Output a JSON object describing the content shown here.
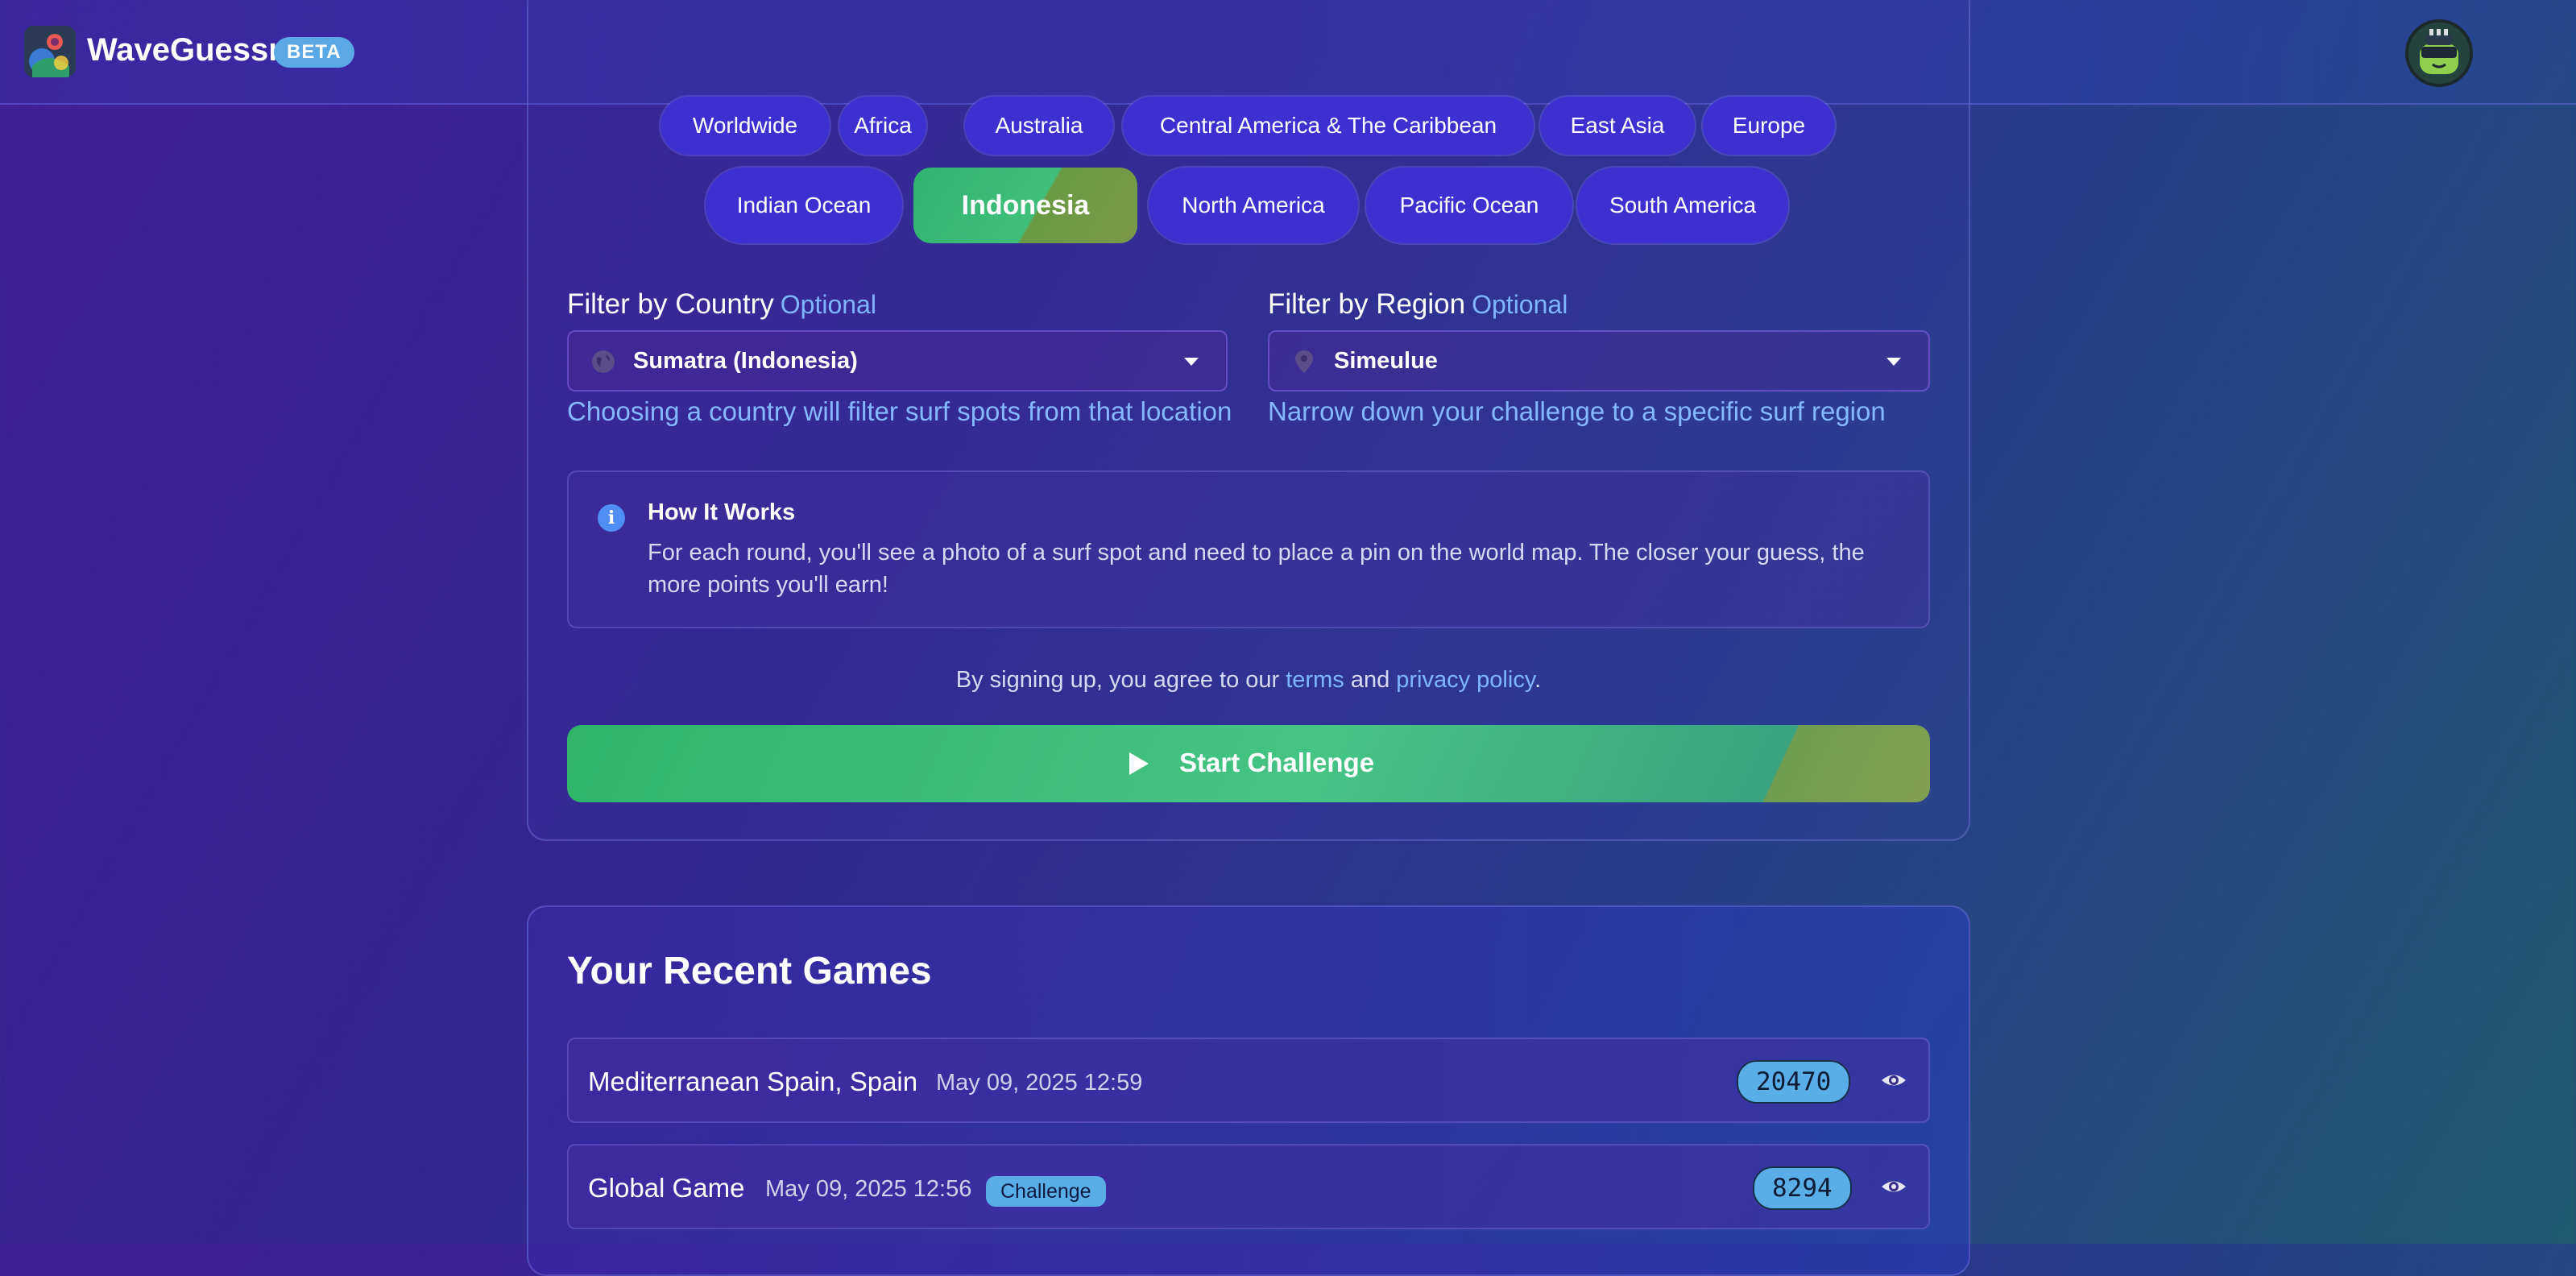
{
  "header": {
    "app_title": "WaveGuessr",
    "beta_label": "BETA"
  },
  "regions": {
    "row1": [
      "Worldwide",
      "Africa",
      "Australia",
      "Central America & The Caribbean",
      "East Asia",
      "Europe"
    ],
    "row2": [
      "Indian Ocean",
      "Indonesia",
      "North America",
      "Pacific Ocean",
      "South America"
    ],
    "selected": "Indonesia"
  },
  "filters": {
    "country": {
      "label": "Filter by Country",
      "optional": "Optional",
      "value": "Sumatra (Indonesia)",
      "hint": "Choosing a country will filter surf spots from that location",
      "icon": "globe-icon"
    },
    "region": {
      "label": "Filter by Region",
      "optional": "Optional",
      "value": "Simeulue",
      "hint": "Narrow down your challenge to a specific surf region",
      "icon": "map-pin-icon"
    }
  },
  "how_it_works": {
    "title": "How It Works",
    "text": "For each round, you'll see a photo of a surf spot and need to place a pin on the world map. The closer your guess, the more points you'll earn!"
  },
  "signup": {
    "prefix": "By signing up, you agree to our",
    "terms": "terms",
    "and": "and",
    "privacy": "privacy policy",
    "suffix": "."
  },
  "start_button": "Start Challenge",
  "recent": {
    "title": "Your Recent Games",
    "games": [
      {
        "name": "Mediterranean Spain, Spain",
        "date": "May 09, 2025 12:59",
        "badge": "",
        "score": "20470"
      },
      {
        "name": "Global Game",
        "date": "May 09, 2025 12:56",
        "badge": "Challenge",
        "score": "8294"
      }
    ]
  },
  "colors": {
    "accent_blue": "#5aaee8",
    "pill": "#3e2fd0",
    "selected_green": "#3fbf7a",
    "link": "#7fb6ff"
  }
}
